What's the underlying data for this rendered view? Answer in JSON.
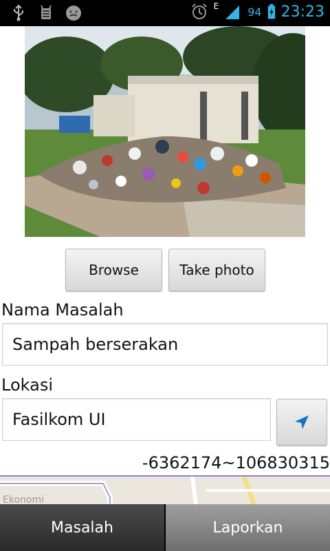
{
  "status_bar": {
    "network_type": "E",
    "battery_percent": "94",
    "time": "23:23",
    "icons": [
      "usb-icon",
      "android-debug-icon",
      "face-icon",
      "alarm-icon",
      "signal-icon",
      "battery-icon"
    ]
  },
  "buttons": {
    "browse": "Browse",
    "take_photo": "Take photo"
  },
  "form": {
    "nama_label": "Nama Masalah",
    "nama_value": "Sampah berserakan",
    "lokasi_label": "Lokasi",
    "lokasi_value": "Fasilkom UI",
    "coordinates": "-6362174~106830315"
  },
  "map": {
    "label": "Ekonomi"
  },
  "tabs": [
    {
      "label": "Masalah",
      "active": true
    },
    {
      "label": "Laporkan",
      "active": false
    }
  ],
  "colors": {
    "accent": "#33b5e5",
    "locate_arrow": "#1a73c8"
  }
}
